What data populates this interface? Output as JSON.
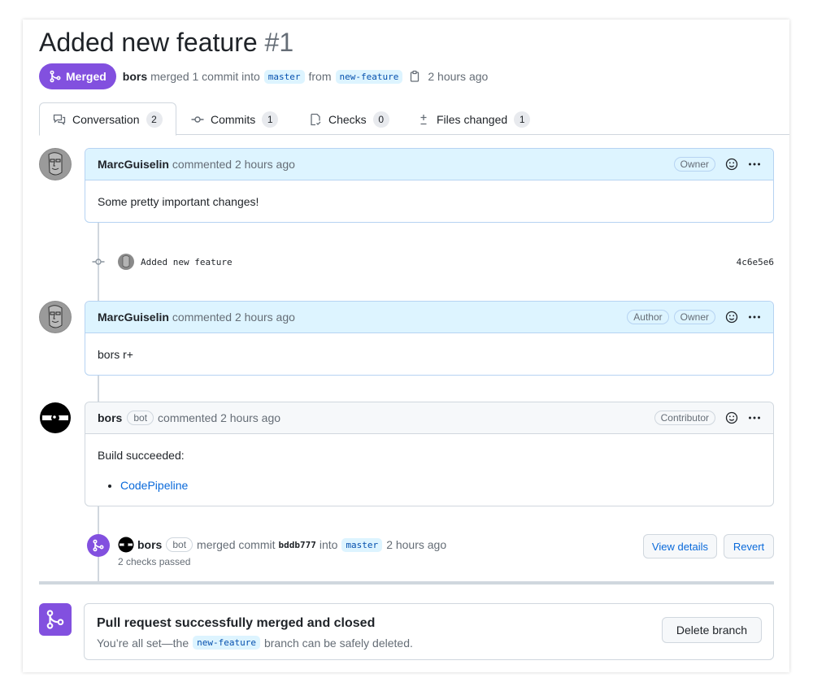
{
  "header": {
    "title": "Added new feature",
    "number": "#1",
    "state": "Merged",
    "merged_by": "bors",
    "merge_text_1": "merged 1 commit into",
    "base_branch": "master",
    "from_text": "from",
    "head_branch": "new-feature",
    "time": "2 hours ago"
  },
  "tabs": [
    {
      "label": "Conversation",
      "count": "2",
      "icon": "comment-discussion-icon"
    },
    {
      "label": "Commits",
      "count": "1",
      "icon": "git-commit-icon"
    },
    {
      "label": "Checks",
      "count": "0",
      "icon": "checklist-icon"
    },
    {
      "label": "Files changed",
      "count": "1",
      "icon": "file-diff-icon"
    }
  ],
  "comments": [
    {
      "author": "MarcGuiselin",
      "action": "commented 2 hours ago",
      "labels": [
        "Owner"
      ],
      "body": "Some pretty important changes!"
    },
    {
      "author": "MarcGuiselin",
      "action": "commented 2 hours ago",
      "labels": [
        "Author",
        "Owner"
      ],
      "body": "bors r+"
    },
    {
      "author": "bors",
      "bot_label": "bot",
      "action": "commented 2 hours ago",
      "labels": [
        "Contributor"
      ],
      "body": "Build succeeded:",
      "list_item": "CodePipeline"
    }
  ],
  "commit": {
    "message": "Added new feature",
    "sha": "4c6e5e6"
  },
  "merge_event": {
    "author": "bors",
    "bot_label": "bot",
    "text": "merged commit",
    "sha": "bddb777",
    "into": "into",
    "branch": "master",
    "time": "2 hours ago",
    "checks": "2 checks passed",
    "view_details": "View details",
    "revert": "Revert"
  },
  "merged_box": {
    "title": "Pull request successfully merged and closed",
    "sub_before": "You’re all set—the",
    "branch": "new-feature",
    "sub_after": "branch can be safely deleted.",
    "delete_button": "Delete branch"
  },
  "colors": {
    "merged_purple": "#8250df",
    "link_blue": "#0969da",
    "owner_header_bg": "#ddf4ff"
  }
}
